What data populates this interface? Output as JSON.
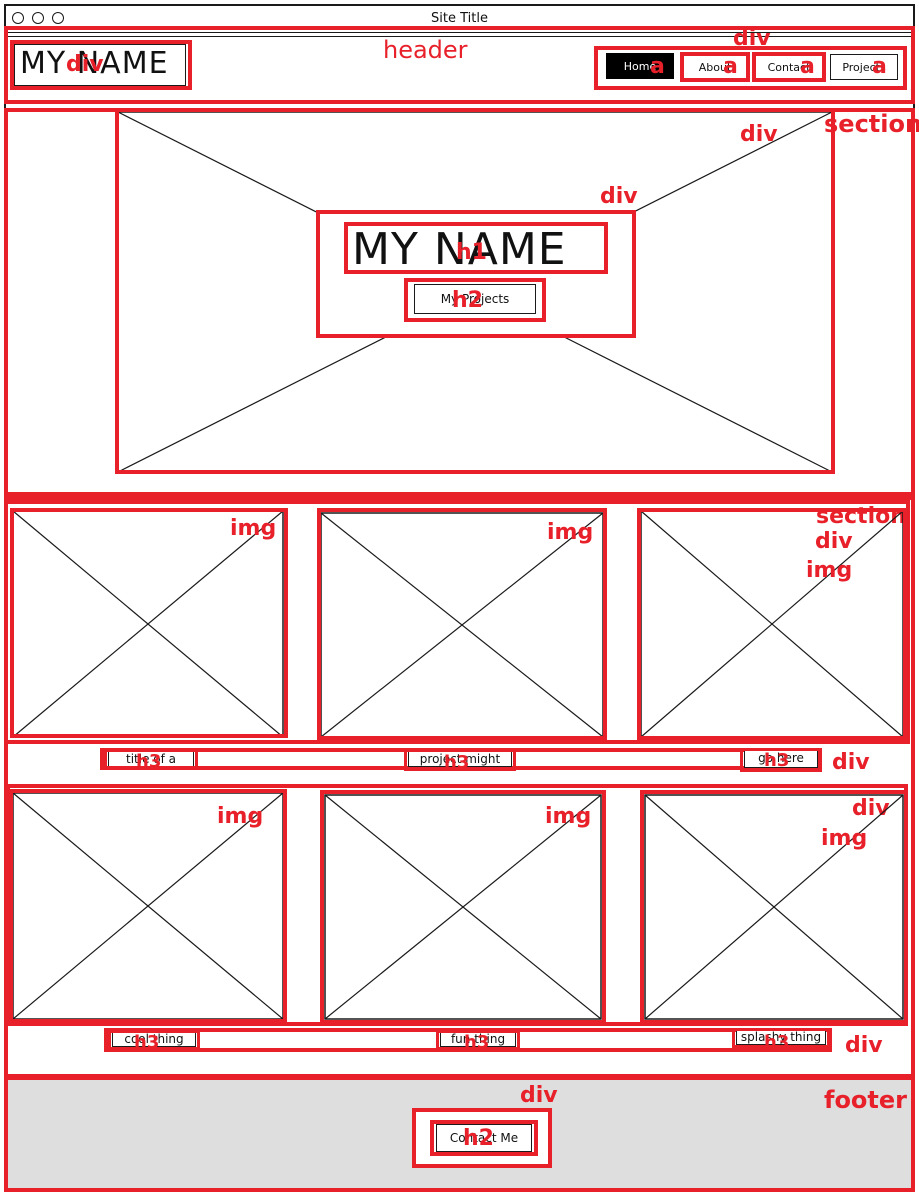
{
  "browser": {
    "site_title": "Site Title"
  },
  "header": {
    "logo": "MY NAME",
    "nav": [
      {
        "label": "Home",
        "active": true
      },
      {
        "label": "About",
        "active": false
      },
      {
        "label": "Contact",
        "active": false
      },
      {
        "label": "Projects",
        "active": false
      }
    ]
  },
  "hero": {
    "title": "MY NAME",
    "button": "My Projects"
  },
  "projects": {
    "row1_captions": [
      "title of a",
      "project might",
      "go here"
    ],
    "row2_captions": [
      "cool thing",
      "fun thing",
      "splashy thing"
    ]
  },
  "footer": {
    "button": "Contact Me"
  },
  "annotations": {
    "header": "header",
    "section_hero": "section",
    "section_projects": "section",
    "footer": "footer",
    "logo_div": "div",
    "nav_div": "div",
    "hero_div": "div",
    "hero_inner_div": "div",
    "h1": "h1",
    "h2_hero": "h2",
    "links": [
      "a",
      "a",
      "a",
      "a"
    ],
    "row1_imgs": [
      "img",
      "img",
      "img"
    ],
    "row1_div": "div",
    "row1_caption_div": "div",
    "row1_h3": [
      "h3",
      "h3",
      "h3"
    ],
    "row2_imgs": [
      "img",
      "img",
      "img"
    ],
    "row2_div": "div",
    "row2_caption_div": "div",
    "row2_h3": [
      "h3",
      "h3",
      "h3"
    ],
    "footer_div": "div",
    "h2_footer": "h2"
  },
  "colors": {
    "annotation": "#e8202a",
    "ink": "#1a1a1a",
    "footer_bg": "#dedede",
    "active_nav": "#000000"
  }
}
